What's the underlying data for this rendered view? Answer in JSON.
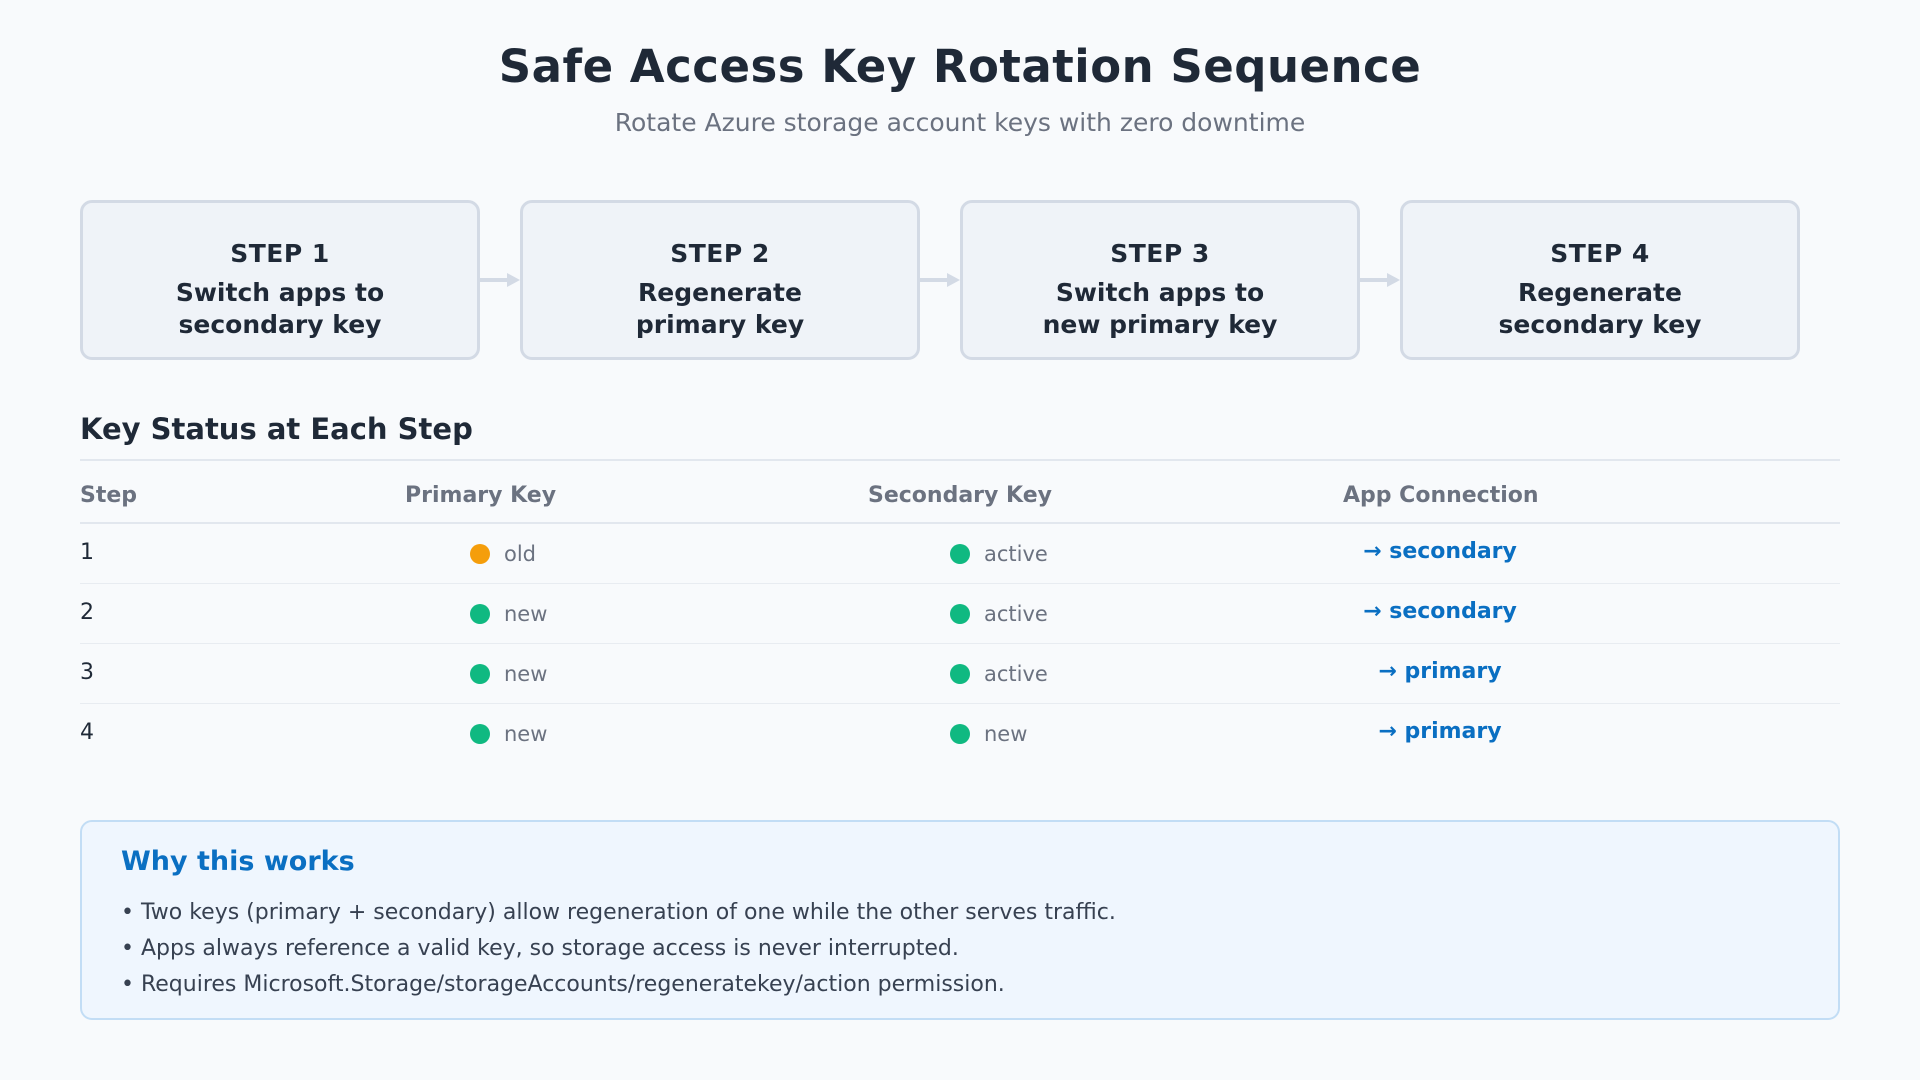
{
  "header": {
    "title": "Safe Access Key Rotation Sequence",
    "subtitle": "Rotate Azure storage account keys with zero downtime"
  },
  "steps": [
    {
      "number": "STEP 1",
      "line1": "Switch apps to",
      "line2": "secondary key"
    },
    {
      "number": "STEP 2",
      "line1": "Regenerate",
      "line2": "primary key"
    },
    {
      "number": "STEP 3",
      "line1": "Switch apps to",
      "line2": "new primary key"
    },
    {
      "number": "STEP 4",
      "line1": "Regenerate",
      "line2": "secondary key"
    }
  ],
  "status_section": {
    "heading": "Key Status at Each Step",
    "columns": [
      "Step",
      "Primary Key",
      "Secondary Key",
      "App Connection"
    ],
    "rows": [
      {
        "step": "1",
        "primary": "old",
        "primary_color": "#f59e0b",
        "secondary": "active",
        "secondary_color": "#10b981",
        "connection": "→ secondary"
      },
      {
        "step": "2",
        "primary": "new",
        "primary_color": "#10b981",
        "secondary": "active",
        "secondary_color": "#10b981",
        "connection": "→ secondary"
      },
      {
        "step": "3",
        "primary": "new",
        "primary_color": "#10b981",
        "secondary": "active",
        "secondary_color": "#10b981",
        "connection": "→ primary"
      },
      {
        "step": "4",
        "primary": "new",
        "primary_color": "#10b981",
        "secondary": "new",
        "secondary_color": "#10b981",
        "connection": "→ primary"
      }
    ]
  },
  "note": {
    "title": "Why this works",
    "items": [
      "• Two keys (primary + secondary) allow regeneration of one while the other serves traffic.",
      "• Apps always reference a valid key, so storage access is never interrupted.",
      "• Requires Microsoft.Storage/storageAccounts/regeneratekey/action permission."
    ]
  },
  "colors": {
    "accent": "#0a6fc2",
    "status_old": "#f59e0b",
    "status_ok": "#10b981"
  }
}
